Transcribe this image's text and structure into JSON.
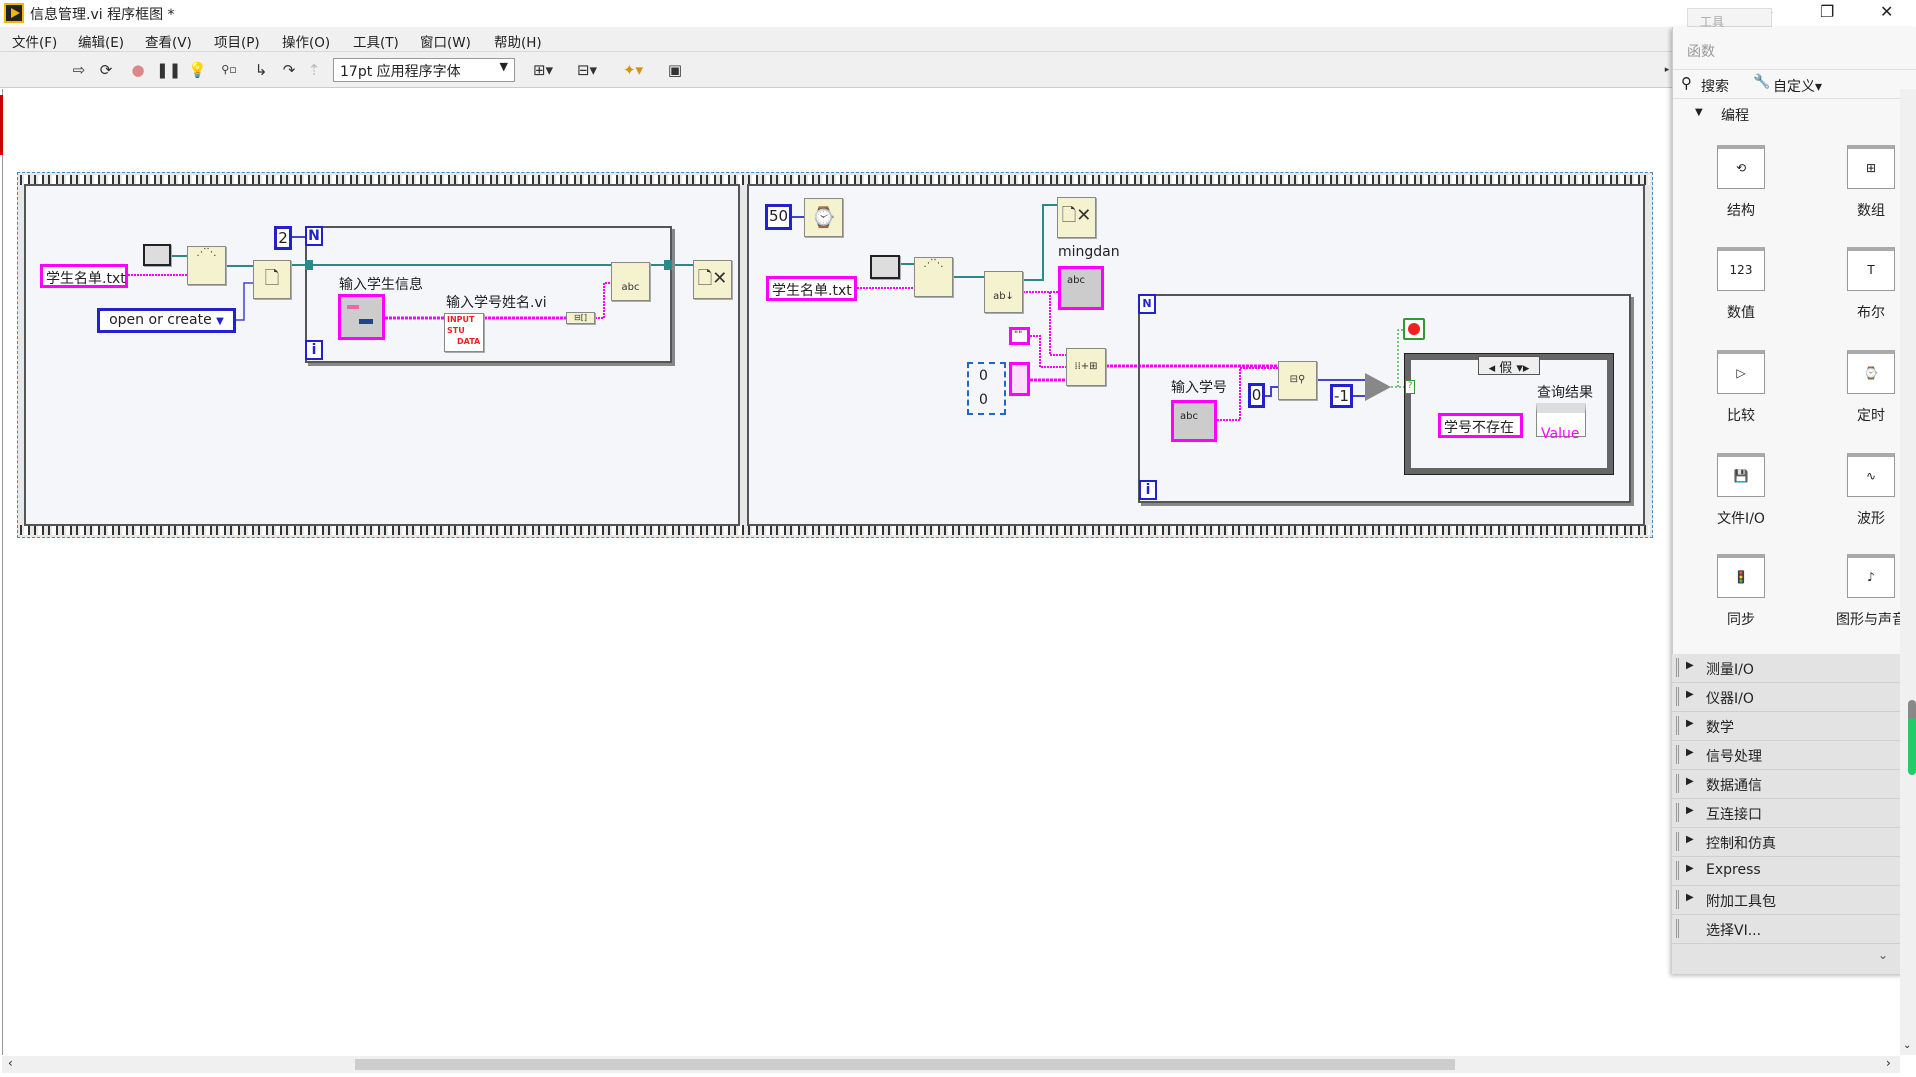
{
  "window": {
    "title": "信息管理.vi 程序框图 *",
    "minimize": "–",
    "restore": "❐",
    "close": "✕"
  },
  "menu": [
    "文件(F)",
    "编辑(E)",
    "查看(V)",
    "项目(P)",
    "操作(O)",
    "工具(T)",
    "窗口(W)",
    "帮助(H)"
  ],
  "toolbar": {
    "font_select": "17pt 应用程序字体",
    "icons": [
      "run-icon",
      "run-continuously-icon",
      "abort-icon",
      "pause-icon",
      "highlight-execution-icon",
      "retain-wire-values-icon",
      "step-into-icon",
      "step-over-icon",
      "step-out-icon",
      "align-icon",
      "distribute-icon",
      "reorder-icon",
      "cleanup-icon"
    ]
  },
  "diagram": {
    "frame1": {
      "path_const": "学生名单.txt",
      "open_mode": "open or create",
      "loop_count": "2",
      "loop_N": "N",
      "loop_i": "i",
      "cluster_label": "输入学生信息",
      "subvi_label": "输入学号姓名.vi",
      "subvi_text": [
        "INPUT",
        "STU",
        "DATA"
      ],
      "write_icon": "abc"
    },
    "frame2": {
      "wait_ms": "50",
      "path_const": "学生名单.txt",
      "indicator_label": "mingdan",
      "indicator_text": "abc",
      "empty_string": "\"\"",
      "array_values": [
        "0",
        "0"
      ],
      "loop_i": "i",
      "input_label": "输入学号",
      "input_text": "abc",
      "start_index": "0",
      "not_found": "-1",
      "case_selector": "假",
      "result_label": "查询结果",
      "result_const": "学号不存在",
      "result_value": "Value"
    }
  },
  "palette": {
    "tools_tab": "工具",
    "title": "函数",
    "search": "搜索",
    "customize": "自定义▾",
    "section": "编程",
    "items": [
      {
        "label": "结构",
        "icon": "structures-icon"
      },
      {
        "label": "数组",
        "icon": "array-icon"
      },
      {
        "label": "数值",
        "icon": "numeric-icon"
      },
      {
        "label": "布尔",
        "icon": "boolean-icon"
      },
      {
        "label": "比较",
        "icon": "comparison-icon"
      },
      {
        "label": "定时",
        "icon": "timing-icon"
      },
      {
        "label": "文件I/O",
        "icon": "file-io-icon"
      },
      {
        "label": "波形",
        "icon": "waveform-icon"
      },
      {
        "label": "同步",
        "icon": "synchronization-icon"
      },
      {
        "label": "图形与声音",
        "icon": "graphics-sound-icon"
      }
    ],
    "categories": [
      "测量I/O",
      "仪器I/O",
      "数学",
      "信号处理",
      "数据通信",
      "互连接口",
      "控制和仿真",
      "Express",
      "附加工具包",
      "选择VI..."
    ]
  },
  "colors": {
    "string_wire": "#ff00ff",
    "refnum_wire": "#2a8a8a",
    "numeric_wire": "#2222cc",
    "node_fill": "#f4f2cf"
  }
}
